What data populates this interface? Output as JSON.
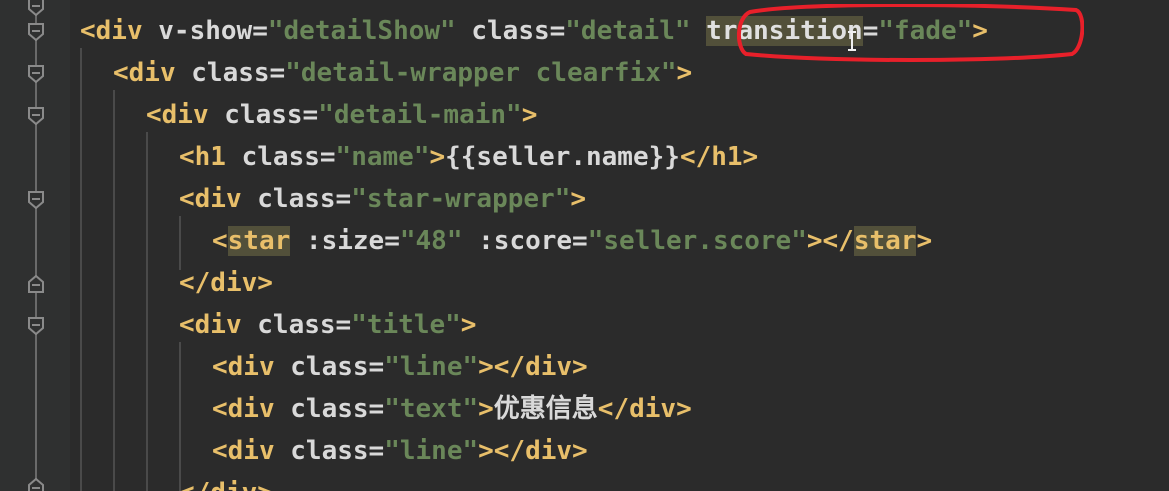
{
  "editor": {
    "lines": [
      {
        "segments": [
          {
            "t": "<div ",
            "c": "tag"
          },
          {
            "t": "v-show=",
            "c": "attr"
          },
          {
            "t": "\"detailShow\"",
            "c": "val"
          },
          {
            "t": " class=",
            "c": "attr"
          },
          {
            "t": "\"detail\"",
            "c": "val"
          },
          {
            "t": " ",
            "c": "attr"
          },
          {
            "t": "transition",
            "c": "hl-attr"
          },
          {
            "t": "=",
            "c": "attr"
          },
          {
            "t": "\"fade\"",
            "c": "val"
          },
          {
            "t": ">",
            "c": "tag"
          }
        ]
      },
      {
        "segments": [
          {
            "t": "<div ",
            "c": "tag"
          },
          {
            "t": "class=",
            "c": "attr"
          },
          {
            "t": "\"detail-wrapper clearfix\"",
            "c": "val"
          },
          {
            "t": ">",
            "c": "tag"
          }
        ]
      },
      {
        "segments": [
          {
            "t": "<div ",
            "c": "tag"
          },
          {
            "t": "class=",
            "c": "attr"
          },
          {
            "t": "\"detail-main\"",
            "c": "val"
          },
          {
            "t": ">",
            "c": "tag"
          }
        ]
      },
      {
        "segments": [
          {
            "t": "<h1 ",
            "c": "tag"
          },
          {
            "t": "class=",
            "c": "attr"
          },
          {
            "t": "\"name\"",
            "c": "val"
          },
          {
            "t": ">",
            "c": "tag"
          },
          {
            "t": "{{seller.name}}",
            "c": "text"
          },
          {
            "t": "</h1>",
            "c": "tag"
          }
        ]
      },
      {
        "segments": [
          {
            "t": "<div ",
            "c": "tag"
          },
          {
            "t": "class=",
            "c": "attr"
          },
          {
            "t": "\"star-wrapper\"",
            "c": "val"
          },
          {
            "t": ">",
            "c": "tag"
          }
        ]
      },
      {
        "segments": [
          {
            "t": "<",
            "c": "tag"
          },
          {
            "t": "star",
            "c": "hl"
          },
          {
            "t": " :size=",
            "c": "attr"
          },
          {
            "t": "\"48\"",
            "c": "val"
          },
          {
            "t": " :score=",
            "c": "attr"
          },
          {
            "t": "\"seller.score\"",
            "c": "val"
          },
          {
            "t": "></",
            "c": "tag"
          },
          {
            "t": "star",
            "c": "hl"
          },
          {
            "t": ">",
            "c": "tag"
          }
        ]
      },
      {
        "segments": [
          {
            "t": "</div>",
            "c": "tag"
          }
        ]
      },
      {
        "segments": [
          {
            "t": "<div ",
            "c": "tag"
          },
          {
            "t": "class=",
            "c": "attr"
          },
          {
            "t": "\"title\"",
            "c": "val"
          },
          {
            "t": ">",
            "c": "tag"
          }
        ]
      },
      {
        "segments": [
          {
            "t": "<div ",
            "c": "tag"
          },
          {
            "t": "class=",
            "c": "attr"
          },
          {
            "t": "\"line\"",
            "c": "val"
          },
          {
            "t": "></div>",
            "c": "tag"
          }
        ]
      },
      {
        "segments": [
          {
            "t": "<div ",
            "c": "tag"
          },
          {
            "t": "class=",
            "c": "attr"
          },
          {
            "t": "\"text\"",
            "c": "val"
          },
          {
            "t": ">",
            "c": "tag"
          },
          {
            "t": "优惠信息",
            "c": "text"
          },
          {
            "t": "</div>",
            "c": "tag"
          }
        ]
      },
      {
        "segments": [
          {
            "t": "<div ",
            "c": "tag"
          },
          {
            "t": "class=",
            "c": "attr"
          },
          {
            "t": "\"line\"",
            "c": "val"
          },
          {
            "t": "></div>",
            "c": "tag"
          }
        ]
      },
      {
        "segments": [
          {
            "t": "</div>",
            "c": "tag"
          }
        ]
      }
    ],
    "annotation_color": "#e8202a",
    "colors": {
      "background": "#2b2b2b",
      "tag": "#e8bf6a",
      "string": "#6a8759",
      "attribute": "#d9d9d9",
      "highlight": "#52503a"
    }
  }
}
